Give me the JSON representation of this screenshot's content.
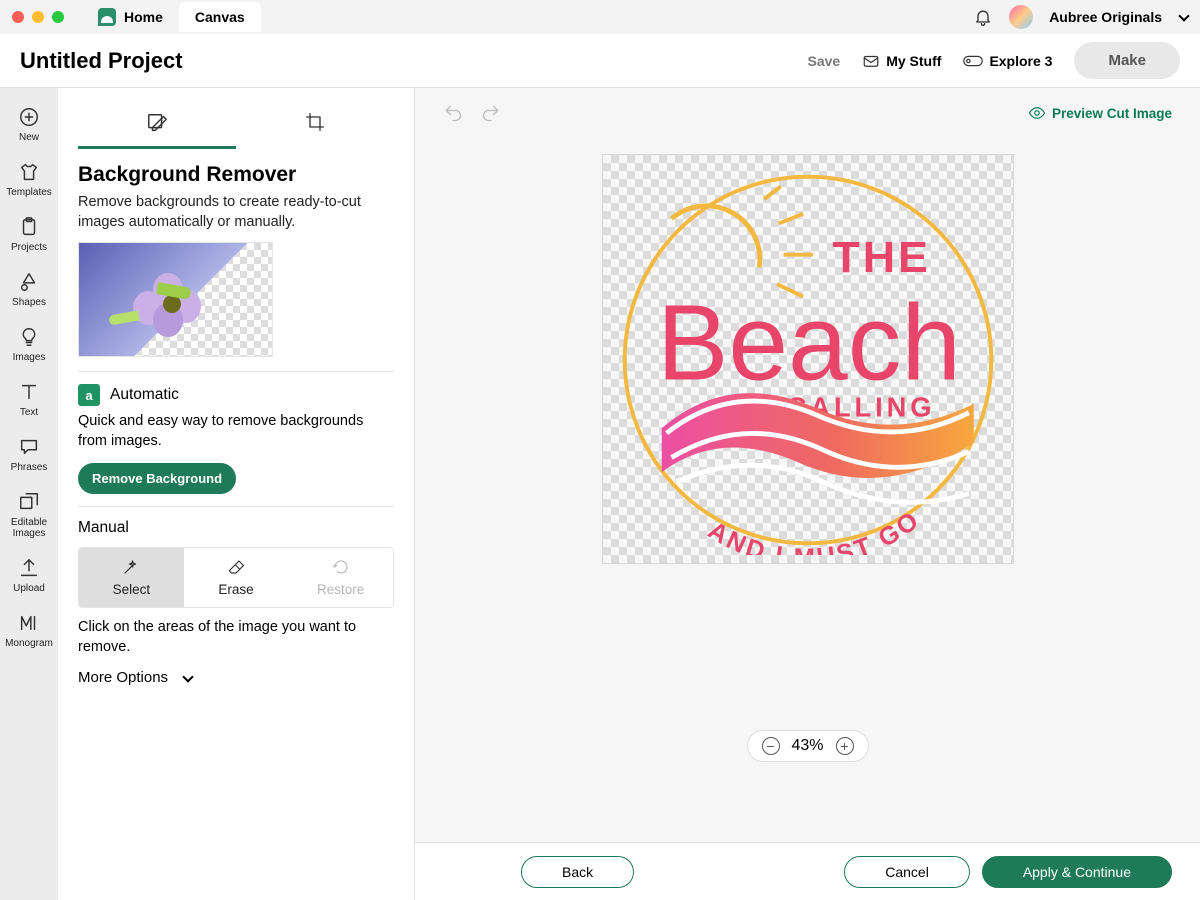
{
  "titlebar": {
    "tabs": [
      {
        "label": "Home",
        "name": "tab-home",
        "active": false
      },
      {
        "label": "Canvas",
        "name": "tab-canvas",
        "active": true
      }
    ],
    "username": "Aubree Originals"
  },
  "header": {
    "project_title": "Untitled Project",
    "save": "Save",
    "my_stuff": "My Stuff",
    "explore": "Explore 3",
    "make": "Make"
  },
  "rail": [
    {
      "name": "rail-new",
      "label": "New"
    },
    {
      "name": "rail-templates",
      "label": "Templates"
    },
    {
      "name": "rail-projects",
      "label": "Projects"
    },
    {
      "name": "rail-shapes",
      "label": "Shapes"
    },
    {
      "name": "rail-images",
      "label": "Images"
    },
    {
      "name": "rail-text",
      "label": "Text"
    },
    {
      "name": "rail-phrases",
      "label": "Phrases"
    },
    {
      "name": "rail-editable-images",
      "label": "Editable Images"
    },
    {
      "name": "rail-upload",
      "label": "Upload"
    },
    {
      "name": "rail-monogram",
      "label": "Monogram"
    }
  ],
  "panel": {
    "title": "Background Remover",
    "lead": "Remove backgrounds to create ready-to-cut images automatically or manually.",
    "automatic": {
      "label": "Automatic",
      "icon_letter": "a",
      "desc": "Quick and easy way to remove backgrounds from images.",
      "button": "Remove Background"
    },
    "manual": {
      "label": "Manual",
      "select": "Select",
      "erase": "Erase",
      "restore": "Restore",
      "instruction": "Click on the areas of the image you want to remove."
    },
    "more_options": "More Options"
  },
  "canvas": {
    "preview_label": "Preview Cut Image",
    "artwork": {
      "line1": "THE",
      "line2": "Beach",
      "line3": "IS CALLING",
      "line4": "AND I MUST GO"
    },
    "zoom": "43%"
  },
  "footer": {
    "back": "Back",
    "cancel": "Cancel",
    "apply": "Apply & Continue"
  }
}
